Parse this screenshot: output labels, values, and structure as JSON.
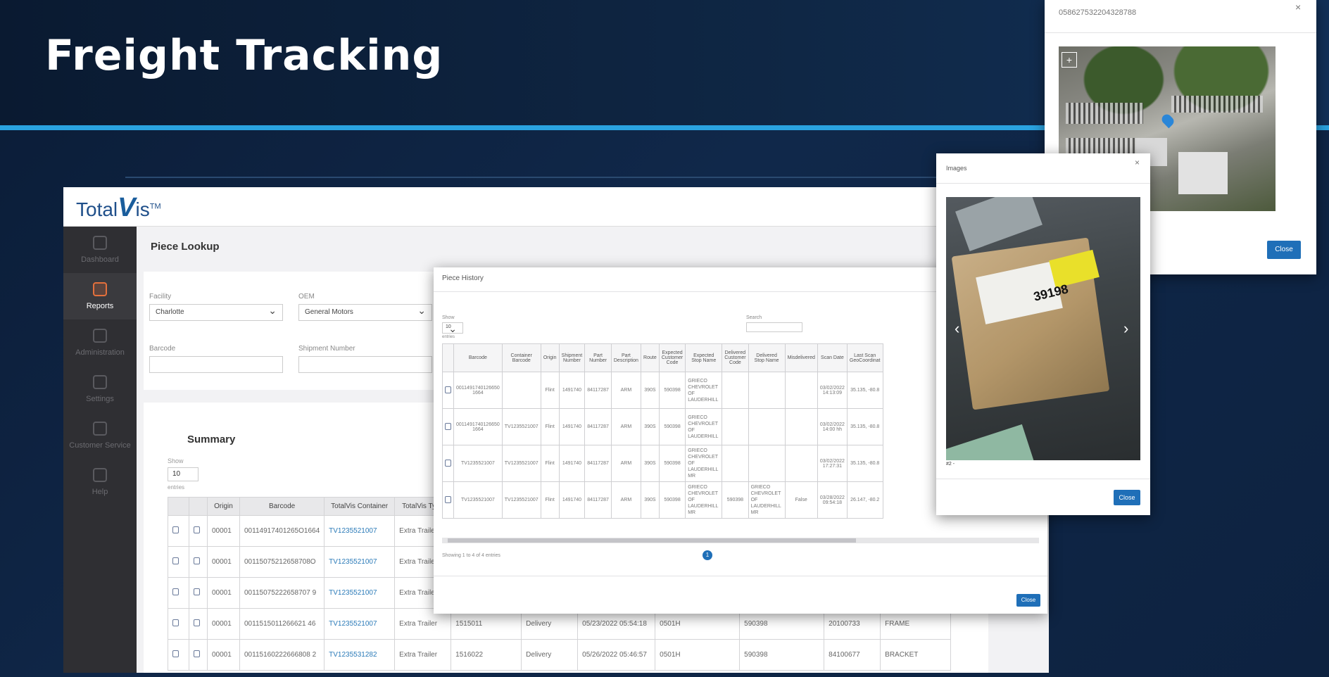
{
  "slide": {
    "title": "Freight Tracking"
  },
  "app": {
    "logo_text": "Total",
    "logo_v": "V",
    "logo_s": "is",
    "logo_tm": "TM",
    "sidebar": [
      {
        "label": "Dashboard",
        "icon": "dashboard-icon",
        "active": false
      },
      {
        "label": "Reports",
        "icon": "reports-icon",
        "active": true
      },
      {
        "label": "Administration",
        "icon": "administration-icon",
        "active": false
      },
      {
        "label": "Settings",
        "icon": "settings-icon",
        "active": false
      },
      {
        "label": "Customer Service",
        "icon": "customer-service-icon",
        "active": false
      },
      {
        "label": "Help",
        "icon": "help-icon",
        "active": false
      }
    ],
    "page_heading": "Piece Lookup",
    "filters": {
      "facility_label": "Facility",
      "facility_value": "Charlotte",
      "oem_label": "OEM",
      "oem_value": "General Motors",
      "barcode_label": "Barcode",
      "shipment_label": "Shipment Number"
    },
    "summary": {
      "title": "Summary",
      "show_label": "Show",
      "show_value": "10",
      "entries_label": "entries",
      "columns": [
        "",
        "",
        "Origin",
        "Barcode",
        "TotalVis Container",
        "TotalVis Type"
      ],
      "rows": [
        [
          "00001",
          "00114917401265O1664",
          "TV1235521007",
          "Extra Trailer",
          "",
          "",
          "",
          "",
          "",
          "",
          ""
        ],
        [
          "00001",
          "00115075212658708O",
          "TV1235521007",
          "Extra Trailer",
          "",
          "",
          "",
          "",
          "",
          "",
          ""
        ],
        [
          "00001",
          "00115075222658707 9",
          "TV1235521007",
          "Extra Trailer",
          "",
          "",
          "",
          "",
          "",
          "",
          ""
        ],
        [
          "00001",
          "0011515011266621 46",
          "TV1235521007",
          "Extra Trailer",
          "1515011",
          "Delivery",
          "05/23/2022 05:54:18",
          "0501H",
          "590398",
          "20100733",
          "FRAME"
        ],
        [
          "00001",
          "00115160222666808 2",
          "TV1235531282",
          "Extra Trailer",
          "1516022",
          "Delivery",
          "05/26/2022 05:46:57",
          "0501H",
          "590398",
          "84100677",
          "BRACKET"
        ]
      ]
    }
  },
  "piece_history": {
    "title": "Piece History",
    "show_label": "Show",
    "show_value": "10",
    "entries_label": "entries",
    "search_label": "Search",
    "columns": [
      "",
      "Barcode",
      "Container Barcode",
      "Origin",
      "Shipment Number",
      "Part Number",
      "Part Description",
      "Route",
      "Expected Customer Code",
      "Expected Stop Name",
      "Delivered Customer Code",
      "Delivered Stop Name",
      "Misdelivered",
      "Scan Date",
      "Last Scan GeoCoordinat"
    ],
    "rows": [
      [
        "",
        "0011491740126650 1664",
        "",
        "Flint",
        "1491740",
        "84117287",
        "ARM",
        "390S",
        "590398",
        "GRIECO CHEVROLET OF LAUDERHILL",
        "",
        "",
        "",
        "03/02/2022 14:13:09",
        "35.135, -80.8"
      ],
      [
        "",
        "0011491740126650 1664",
        "TV1235521007",
        "Flint",
        "1491740",
        "84117287",
        "ARM",
        "390S",
        "590398",
        "GRIECO CHEVROLET OF LAUDERHILL",
        "",
        "",
        "",
        "03/02/2022 14:00 hh",
        "35.135, -80.8"
      ],
      [
        "",
        "TV1235521007",
        "TV1235521007",
        "Flint",
        "1491740",
        "84117287",
        "ARM",
        "390S",
        "590398",
        "GRIECO CHEVROLET OF LAUDERHILL MR",
        "",
        "",
        "",
        "03/02/2022 17:27:31",
        "35.135, -80.8"
      ],
      [
        "",
        "TV1235521007",
        "TV1235521007",
        "Flint",
        "1491740",
        "84117287",
        "ARM",
        "390S",
        "590398",
        "GRIECO CHEVROLET OF LAUDERHILL MR",
        "590398",
        "GRIECO CHEVROLET OF LAUDERHILL MR",
        "False",
        "03/28/2022 09:54:18",
        "26.147, -80.2"
      ]
    ],
    "footer_info": "Showing 1 to 4 of 4 entries",
    "page_current": "1",
    "close_label": "Close"
  },
  "images_modal": {
    "title": "Images",
    "photo_label": "39198",
    "caption": "#2 -",
    "close_label": "Close"
  },
  "map_modal": {
    "title": "058627532204328788",
    "close_label": "Close"
  },
  "colors": {
    "accent_blue": "#2aa3e0",
    "button_blue": "#1f6fb8",
    "sidebar_active": "#e4703c",
    "link": "#2a7ab8"
  }
}
